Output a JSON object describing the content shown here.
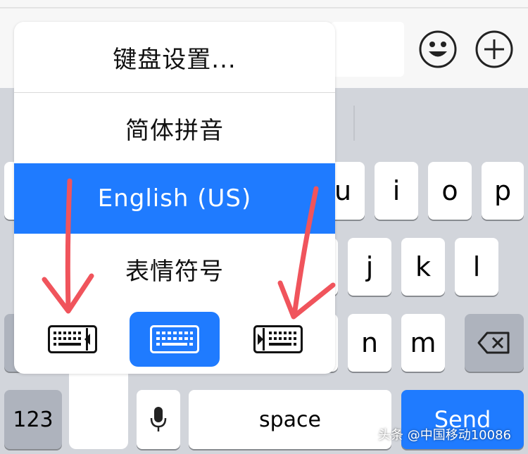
{
  "keyboard_menu": {
    "items": [
      {
        "label": "键盘设置..."
      },
      {
        "label": "简体拼音"
      },
      {
        "label": "English (US)",
        "selected": true
      },
      {
        "label": "表情符号"
      }
    ],
    "layout_options": [
      "keyboard-left-icon",
      "keyboard-full-icon",
      "keyboard-right-icon"
    ],
    "selected_layout": "keyboard-full-icon"
  },
  "keys": {
    "row1": [
      "u",
      "i",
      "o",
      "p"
    ],
    "row2": [
      "j",
      "k",
      "l"
    ],
    "row3": [
      "n",
      "m"
    ],
    "numbers": "123",
    "space": "space",
    "send": "Send"
  },
  "watermark": "头条 @中国移动10086",
  "colors": {
    "accent": "#1f7bff",
    "arrow": "#f0545c",
    "keyboard_bg": "#d2d5db"
  }
}
